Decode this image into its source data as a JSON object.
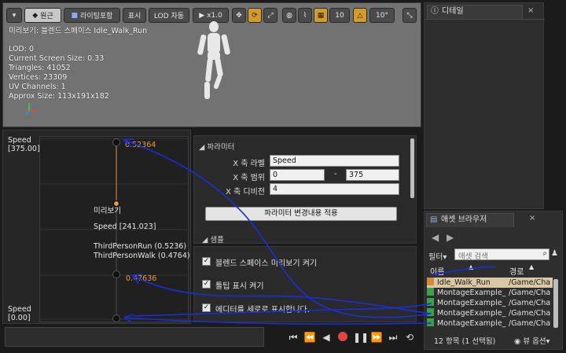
{
  "viewport": {
    "toolbar": {
      "perspective": "원근",
      "lighting": "라이팅포함",
      "show": "표시",
      "lod": "LOD 자동",
      "speed": "x1.0",
      "grid_value": "10",
      "angle_value": "10°"
    },
    "preview_title": "미리보기: 블렌드 스페이스 Idle_Walk_Run",
    "stats": [
      "LOD: 0",
      "Current Screen Size: 0.33",
      "Triangles: 41052",
      "Vertices: 23309",
      "UV Channels: 1",
      "Approx Size: 113x191x182"
    ]
  },
  "graph": {
    "y_max_label": "Speed",
    "y_max_value": "[375.00]",
    "y_min_label": "Speed",
    "y_min_value": "[0.00]",
    "top_weight": "0.52364",
    "mid_weight": "0.47636",
    "preview_label": "미리보기",
    "speed_readout": "Speed [241.023]",
    "anim_run": "ThirdPersonRun (0.5236)",
    "anim_walk": "ThirdPersonWalk (0.4764)"
  },
  "parameters": {
    "section_title": "파라미터",
    "x_label": "X 축 라벨",
    "x_label_value": "Speed",
    "x_range": "X 축 범위",
    "x_range_min": "0",
    "x_range_sep": "-",
    "x_range_max": "375",
    "x_divisions": "X 축 디비전",
    "x_divisions_value": "4",
    "apply_button": "파라미터 변경내용 적용",
    "samples_title": "샘플"
  },
  "options": [
    "블렌드 스페이스 미리보기 켜기",
    "툴팁 표시 켜기",
    "에디터를 세로로 표시합니다."
  ],
  "details": {
    "tab": "디테일"
  },
  "content_browser": {
    "tab": "애셋 브라우저",
    "filter_label": "필터",
    "search_placeholder": "애셋 검색",
    "col_name": "이름",
    "col_path": "경로",
    "assets": [
      {
        "name": "Idle_Walk_Run",
        "path": "/Game/Cha"
      },
      {
        "name": "MontageExample_",
        "path": "/Game/Cha"
      },
      {
        "name": "MontageExample_",
        "path": "/Game/Cha"
      },
      {
        "name": "MontageExample_",
        "path": "/Game/Cha"
      },
      {
        "name": "MontageExample_",
        "path": "/Game/Cha"
      }
    ],
    "status": "12 항목 (1 선택됨)",
    "view_options": "뷰 옵션"
  },
  "colors": {
    "accent_orange": "#e89a3c",
    "annotation_blue": "#1a2fd6",
    "selected_row": "#d9c7a6"
  }
}
